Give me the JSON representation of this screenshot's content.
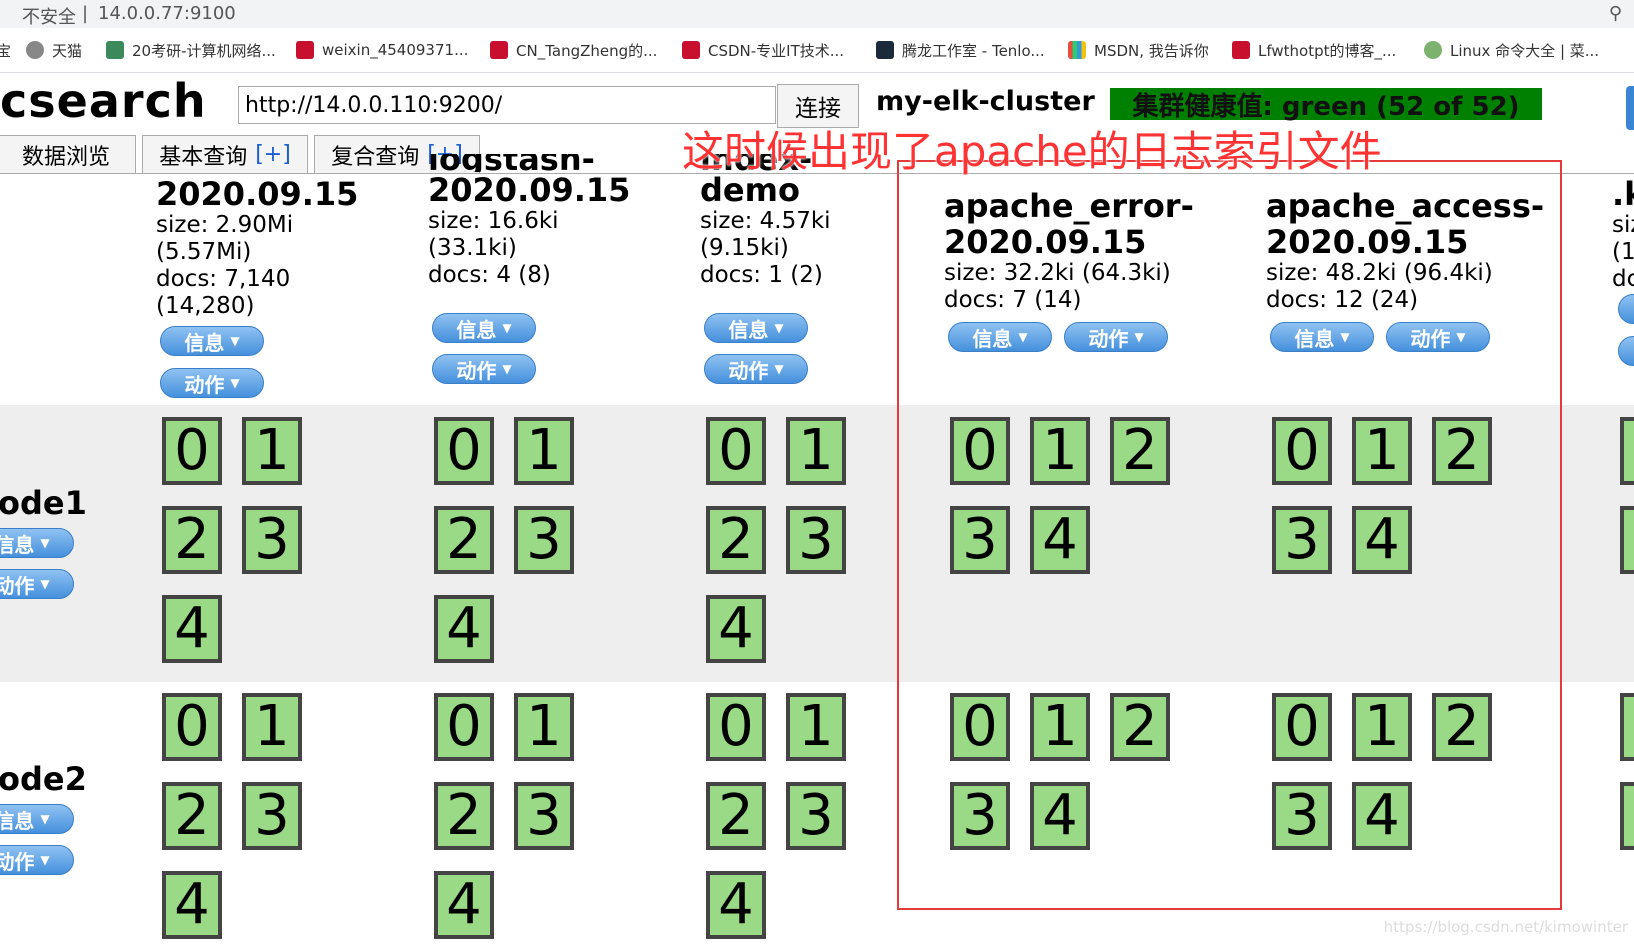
{
  "browser": {
    "security": "不安全",
    "url": "14.0.0.77:9100",
    "bookmarks": [
      "天猫",
      "20考研-计算机网络...",
      "weixin_45409371...",
      "CN_TangZheng的...",
      "CSDN-专业IT技术...",
      "腾龙工作室 - Tenlo...",
      "MSDN, 我告诉你",
      "Lfwthotpt的博客_...",
      "Linux 命令大全 | 菜..."
    ],
    "bookmark_left_cut": "宝"
  },
  "header": {
    "title": "csearch",
    "url_value": "http://14.0.0.110:9200/",
    "connect_label": "连接",
    "cluster_name": "my-elk-cluster",
    "health": "集群健康值: green (52 of 52)",
    "health_color": "#008000"
  },
  "tabs": [
    {
      "label": "数据浏览",
      "plus": ""
    },
    {
      "label": "基本查询",
      "plus": "[+]"
    },
    {
      "label": "复合查询",
      "plus": "[+]"
    }
  ],
  "annotation": "这时候出现了apache的日志索引文件",
  "buttons": {
    "info": "信息",
    "action": "动作"
  },
  "indices": [
    {
      "name_top": "",
      "name": "2020.09.15",
      "size": "size: 2.90Mi",
      "size2": "(5.57Mi)",
      "docs": "docs: 7,140",
      "docs2": "(14,280)"
    },
    {
      "name_top": "logstash-",
      "name": "2020.09.15",
      "size": "size: 16.6ki",
      "size2": "(33.1ki)",
      "docs": "docs: 4 (8)",
      "docs2": ""
    },
    {
      "name_top": "index-",
      "name": "demo",
      "size": "size: 4.57ki",
      "size2": "(9.15ki)",
      "docs": "docs: 1 (2)",
      "docs2": ""
    },
    {
      "name_top": "apache_error-",
      "name": "2020.09.15",
      "size": "size: 32.2ki (64.3ki)",
      "size2": "",
      "docs": "docs: 7 (14)",
      "docs2": ""
    },
    {
      "name_top": "apache_access-",
      "name": "2020.09.15",
      "size": "size: 48.2ki (96.4ki)",
      "size2": "",
      "docs": "docs: 12 (24)",
      "docs2": ""
    }
  ],
  "partial_column": {
    "name": ".k",
    "size": "siz",
    "size2": "(1",
    "docs": "dc"
  },
  "nodes": [
    {
      "label": "ode1",
      "info": "信息",
      "action": "动作"
    },
    {
      "label": "ode2",
      "info": "信息",
      "action": "动作"
    }
  ],
  "shards": [
    "0",
    "1",
    "2",
    "3",
    "4"
  ],
  "watermark": "https://blog.csdn.net/kimowinter"
}
